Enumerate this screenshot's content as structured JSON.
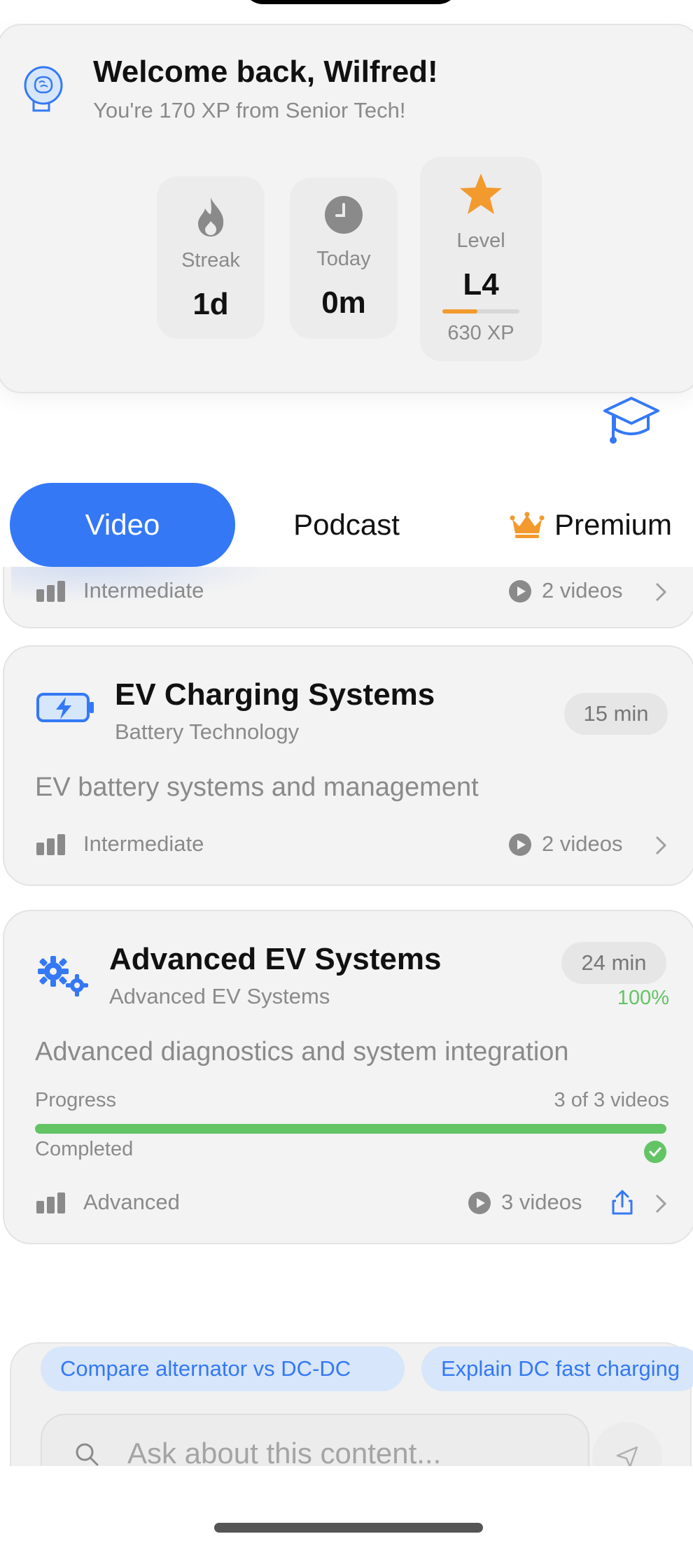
{
  "header": {
    "welcome": "Welcome back, Wilfred!",
    "subtitle": "You're 170 XP from Senior Tech!",
    "stats": [
      {
        "label": "Streak",
        "value": "1d",
        "icon": "flame-icon"
      },
      {
        "label": "Today",
        "value": "0m",
        "icon": "clock-icon"
      },
      {
        "label": "Level",
        "value": "L4",
        "icon": "star-icon",
        "xp": "630 XP",
        "progress": 0.45
      }
    ],
    "accent": "#3478f6",
    "star_color": "#f29a2e"
  },
  "tabs": {
    "video": "Video",
    "podcast": "Podcast",
    "premium": "Premium"
  },
  "cards": [
    {
      "level": "Intermediate",
      "videos": "2 videos"
    },
    {
      "title": "EV Charging Systems",
      "category": "Battery Technology",
      "duration": "15 min",
      "description": "EV battery systems and management",
      "level": "Intermediate",
      "videos": "2 videos",
      "icon": "battery-charging-icon"
    },
    {
      "title": "Advanced EV Systems",
      "category": "Advanced EV Systems",
      "duration": "24 min",
      "percent": "100%",
      "description": "Advanced diagnostics and system integration",
      "progress_label": "Progress",
      "progress_count": "3 of 3 videos",
      "progress": 1.0,
      "status": "Completed",
      "level": "Advanced",
      "videos": "3 videos",
      "icon": "gears-icon",
      "progress_color": "#63c466"
    }
  ],
  "assistant": {
    "chips": [
      "Compare alternator vs DC-DC",
      "Explain DC fast charging"
    ],
    "placeholder": "Ask about this content..."
  }
}
